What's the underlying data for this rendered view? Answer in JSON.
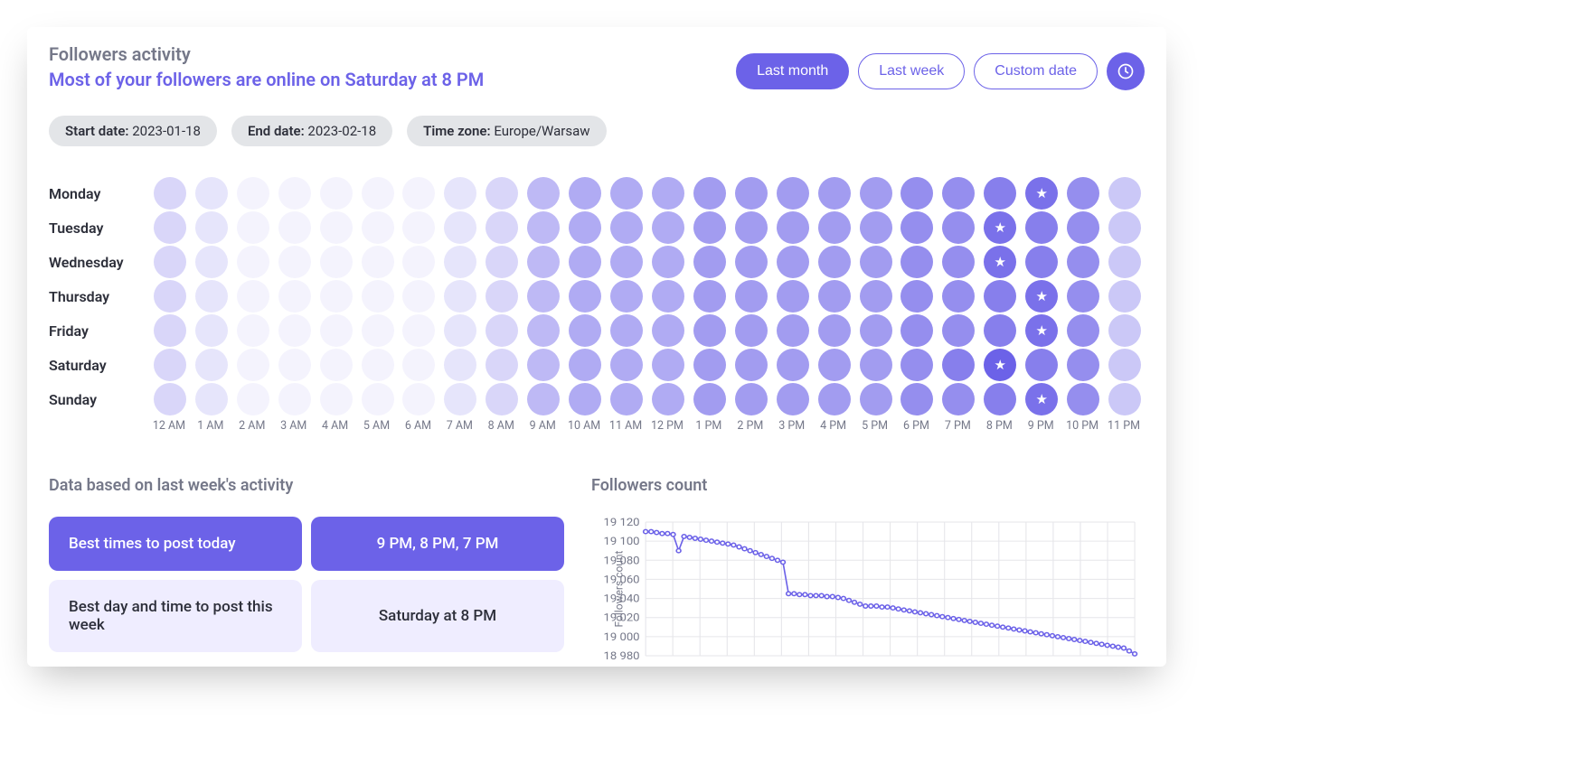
{
  "header": {
    "title": "Followers activity",
    "subtitle": "Most of your followers are online on Saturday at 8 PM"
  },
  "controls": {
    "last_month": "Last month",
    "last_week": "Last week",
    "custom_date": "Custom date"
  },
  "meta": {
    "start_label": "Start date:",
    "start_value": "2023-01-18",
    "end_label": "End date:",
    "end_value": "2023-02-18",
    "tz_label": "Time zone:",
    "tz_value": "Europe/Warsaw"
  },
  "heatmap": {
    "days": [
      "Monday",
      "Tuesday",
      "Wednesday",
      "Thursday",
      "Friday",
      "Saturday",
      "Sunday"
    ],
    "hours": [
      "12 AM",
      "1 AM",
      "2 AM",
      "3 AM",
      "4 AM",
      "5 AM",
      "6 AM",
      "7 AM",
      "8 AM",
      "9 AM",
      "10 AM",
      "11 AM",
      "12 PM",
      "1 PM",
      "2 PM",
      "3 PM",
      "4 PM",
      "5 PM",
      "6 PM",
      "7 PM",
      "8 PM",
      "9 PM",
      "10 PM",
      "11 PM"
    ],
    "intensity": [
      [
        2,
        1,
        0,
        0,
        0,
        0,
        0,
        1,
        2,
        4,
        5,
        5,
        5,
        6,
        6,
        6,
        6,
        6,
        7,
        7,
        8,
        9,
        7,
        3
      ],
      [
        2,
        1,
        0,
        0,
        0,
        0,
        0,
        1,
        2,
        4,
        5,
        5,
        5,
        6,
        6,
        6,
        6,
        6,
        7,
        7,
        9,
        8,
        7,
        3
      ],
      [
        2,
        1,
        0,
        0,
        0,
        0,
        0,
        1,
        2,
        4,
        5,
        5,
        5,
        6,
        6,
        6,
        6,
        6,
        7,
        7,
        9,
        8,
        7,
        3
      ],
      [
        2,
        1,
        0,
        0,
        0,
        0,
        0,
        1,
        2,
        4,
        5,
        5,
        5,
        6,
        6,
        6,
        6,
        6,
        7,
        7,
        8,
        9,
        7,
        3
      ],
      [
        2,
        1,
        0,
        0,
        0,
        0,
        0,
        1,
        2,
        4,
        5,
        5,
        5,
        6,
        6,
        6,
        6,
        6,
        7,
        7,
        8,
        9,
        7,
        3
      ],
      [
        2,
        1,
        0,
        0,
        0,
        0,
        0,
        1,
        2,
        4,
        5,
        5,
        5,
        6,
        6,
        6,
        6,
        6,
        7,
        8,
        10,
        8,
        7,
        3
      ],
      [
        2,
        1,
        0,
        0,
        0,
        0,
        0,
        1,
        2,
        4,
        5,
        5,
        5,
        6,
        6,
        6,
        6,
        6,
        7,
        7,
        8,
        9,
        7,
        3
      ]
    ],
    "stars": [
      [
        0,
        21
      ],
      [
        1,
        20
      ],
      [
        2,
        20
      ],
      [
        3,
        21
      ],
      [
        4,
        21
      ],
      [
        5,
        20
      ],
      [
        6,
        21
      ]
    ]
  },
  "best": {
    "section_title": "Data based on last week's activity",
    "today_label": "Best times to post today",
    "today_value": "9 PM, 8 PM, 7 PM",
    "week_label": "Best day and time to post this week",
    "week_value": "Saturday at 8 PM"
  },
  "followers_chart": {
    "title": "Followers count",
    "ylabel": "Followers count"
  },
  "chart_data": {
    "type": "line",
    "title": "Followers count",
    "xlabel": "",
    "ylabel": "Followers count",
    "ylim": [
      18980,
      19120
    ],
    "yticks": [
      18980,
      19000,
      19020,
      19040,
      19060,
      19080,
      19100,
      19120
    ],
    "x": [
      0,
      1,
      2,
      3,
      4,
      5,
      6,
      7,
      8,
      9,
      10,
      11,
      12,
      13,
      14,
      15,
      16,
      17,
      18,
      19,
      20,
      21,
      22,
      23,
      24,
      25,
      26,
      27,
      28,
      29,
      30,
      31,
      32,
      33,
      34,
      35,
      36,
      37,
      38,
      39,
      40,
      41,
      42,
      43,
      44,
      45,
      46,
      47,
      48,
      49,
      50,
      51,
      52,
      53,
      54,
      55,
      56,
      57,
      58,
      59,
      60,
      61,
      62,
      63,
      64,
      65,
      66,
      67,
      68,
      69,
      70,
      71,
      72,
      73,
      74,
      75,
      76,
      77,
      78,
      79,
      80,
      81,
      82,
      83,
      84,
      85,
      86,
      87,
      88,
      89
    ],
    "values": [
      19110,
      19110,
      19109,
      19108,
      19108,
      19107,
      19090,
      19105,
      19104,
      19103,
      19102,
      19101,
      19100,
      19099,
      19098,
      19097,
      19096,
      19094,
      19092,
      19090,
      19088,
      19086,
      19084,
      19082,
      19080,
      19078,
      19045,
      19045,
      19044,
      19044,
      19043,
      19043,
      19043,
      19042,
      19042,
      19041,
      19040,
      19038,
      19036,
      19034,
      19032,
      19032,
      19032,
      19031,
      19031,
      19030,
      19029,
      19028,
      19027,
      19026,
      19025,
      19024,
      19023,
      19022,
      19021,
      19020,
      19019,
      19018,
      19017,
      19016,
      19015,
      19014,
      19013,
      19012,
      19011,
      19010,
      19009,
      19008,
      19007,
      19006,
      19005,
      19004,
      19003,
      19002,
      19001,
      19000,
      18999,
      18998,
      18997,
      18996,
      18995,
      18994,
      18993,
      18992,
      18991,
      18990,
      18989,
      18988,
      18985,
      18982
    ]
  }
}
